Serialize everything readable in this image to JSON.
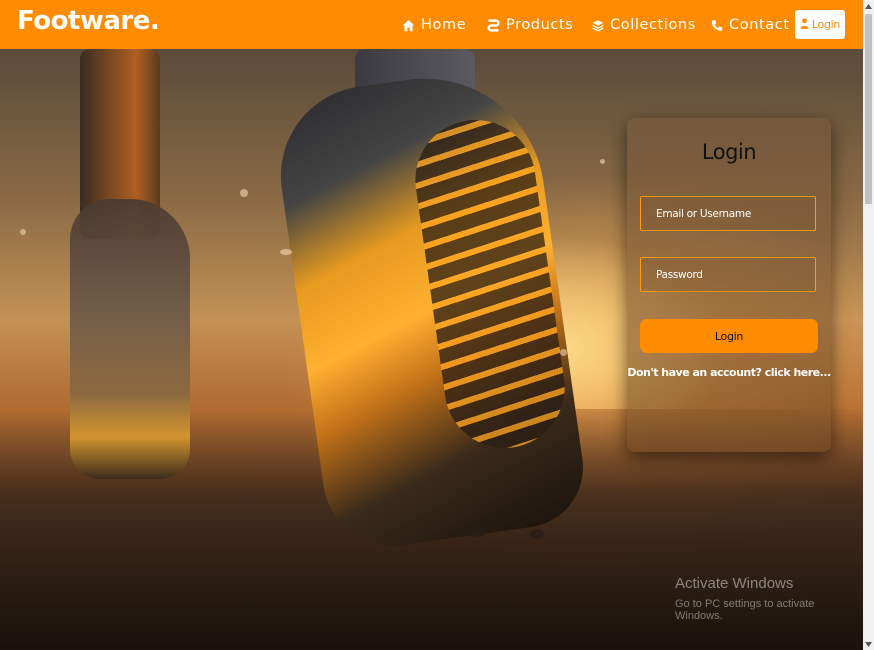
{
  "navbar": {
    "brand": "Footware.",
    "links": [
      {
        "label": "Home",
        "icon": "home-icon"
      },
      {
        "label": "Products",
        "icon": "products-icon"
      },
      {
        "label": "Collections",
        "icon": "layers-icon"
      },
      {
        "label": "Contact",
        "icon": "phone-icon"
      }
    ],
    "login_label": "Login",
    "login_icon": "user-icon"
  },
  "login_card": {
    "title": "Login",
    "email_placeholder": "Email or Username",
    "password_placeholder": "Password",
    "submit_label": "Login",
    "signup_text": "Don't have an account? click here..."
  },
  "watermark": {
    "title": "Activate Windows",
    "subtitle": "Go to PC settings to activate Windows."
  },
  "colors": {
    "accent": "#ff8c00",
    "text_light": "#ffffff"
  }
}
